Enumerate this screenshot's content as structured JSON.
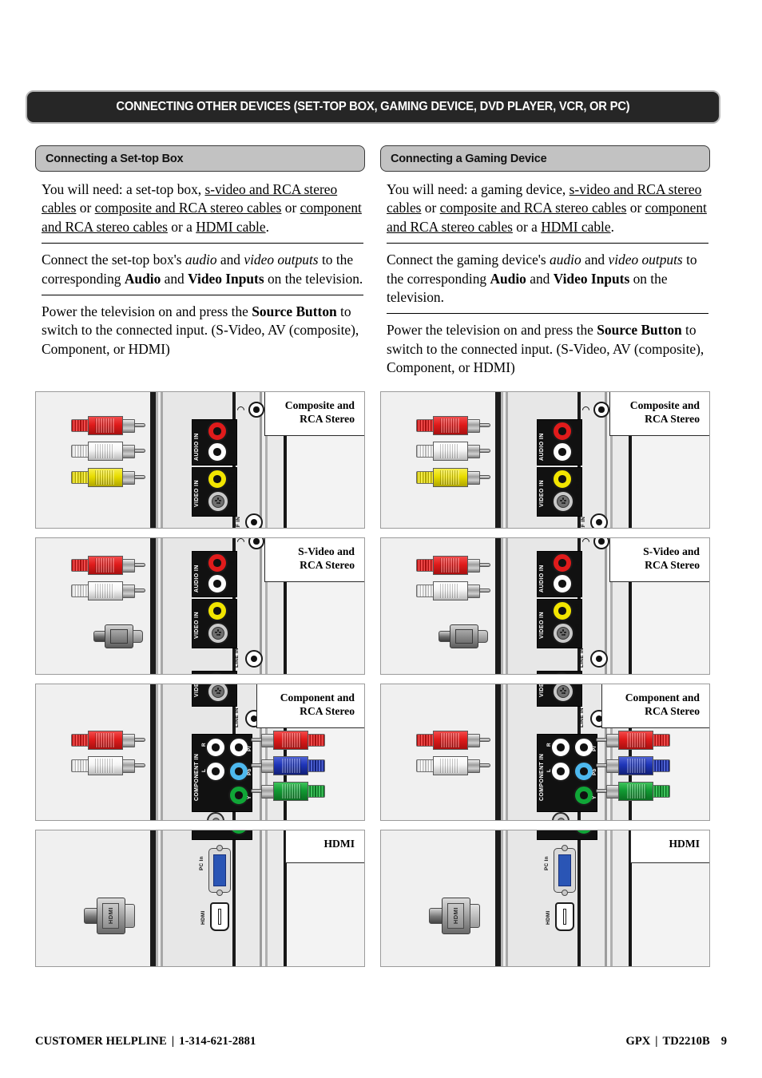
{
  "section_header": "CONNECTING OTHER DEVICES (SET-TOP BOX, GAMING DEVICE, DVD PLAYER, VCR, OR PC)",
  "columns": [
    {
      "heading": "Connecting a Set-top Box",
      "paragraphs": {
        "p1_a": "You  will need: a set-top box, ",
        "p1_u1": "s-video and RCA stereo cables",
        "p1_b": " or ",
        "p1_u2": "composite and RCA stereo cables",
        "p1_c": " or ",
        "p1_u3": "component and RCA stereo cables",
        "p1_d": " or a ",
        "p1_u4": "HDMI cable",
        "p1_e": ".",
        "p2_a": "Connect the set-top box's ",
        "p2_i1": "audio",
        "p2_b": " and ",
        "p2_i2": "video outputs",
        "p2_c": " to the corresponding ",
        "p2_b1": "Audio",
        "p2_d": " and ",
        "p2_b2": "Video Inputs",
        "p2_e": " on the television.",
        "p3_a": "Power the television on and press the ",
        "p3_b1": "Source Button",
        "p3_b": " to switch to the connected input. (S-Video, AV (composite), Component, or HDMI)"
      }
    },
    {
      "heading": "Connecting a Gaming Device",
      "paragraphs": {
        "p1_a": "You  will need: a gaming device, ",
        "p1_u1": "s-video and RCA stereo cables",
        "p1_b": " or ",
        "p1_u2": "composite and RCA stereo cables",
        "p1_c": " or ",
        "p1_u3": "component and RCA stereo cables",
        "p1_d": " or a ",
        "p1_u4": "HDMI cable",
        "p1_e": ".",
        "p2_a": "Connect the gaming device's ",
        "p2_i1": "audio",
        "p2_b": " and ",
        "p2_i2": "video outputs",
        "p2_c": " to the corresponding ",
        "p2_b1": "Audio",
        "p2_d": " and ",
        "p2_b2": "Video Inputs",
        "p2_e": " on the television.",
        "p3_a": "Power the television on and press the ",
        "p3_b1": "Source Button",
        "p3_b": " to switch to the connected input. (S-Video, AV (composite), Component, or HDMI)"
      }
    }
  ],
  "diagram_callouts": [
    "Composite and\nRCA Stereo",
    "S-Video and\nRCA Stereo",
    "Component and\nRCA Stereo",
    "HDMI"
  ],
  "jack_panel_labels": {
    "audio_in": "AUDIO IN",
    "video_in": "VIDEO IN",
    "component_in": "COMPONENT IN",
    "rf_in": "RF IN",
    "line_in": "LINE IN",
    "pc_in": "PC In",
    "hdmi": "HDMI",
    "pin_r": "R",
    "pin_l": "L",
    "pin_video": "VIDEO",
    "pin_svideo": "S-VIDEO",
    "pin_pr": "Pr",
    "pin_pb": "Pb",
    "pin_y": "Y"
  },
  "plug_labels": {
    "hdmi_plug": "HDMI"
  },
  "footer": {
    "helpline_label": "CUSTOMER HELPLINE",
    "separator": "|",
    "phone": "1-314-621-2881",
    "brand": "GPX",
    "model": "TD2210B",
    "page": "9"
  },
  "colors": {
    "header_bg": "#262626",
    "subheader_bg": "#c2c2c2",
    "jack_red": "#e01b1b",
    "jack_white": "#fdfdfd",
    "jack_yellow": "#f2e500",
    "jack_green": "#10a637",
    "jack_blue": "#4db8ee",
    "panel_bg": "#f2f2f2"
  }
}
